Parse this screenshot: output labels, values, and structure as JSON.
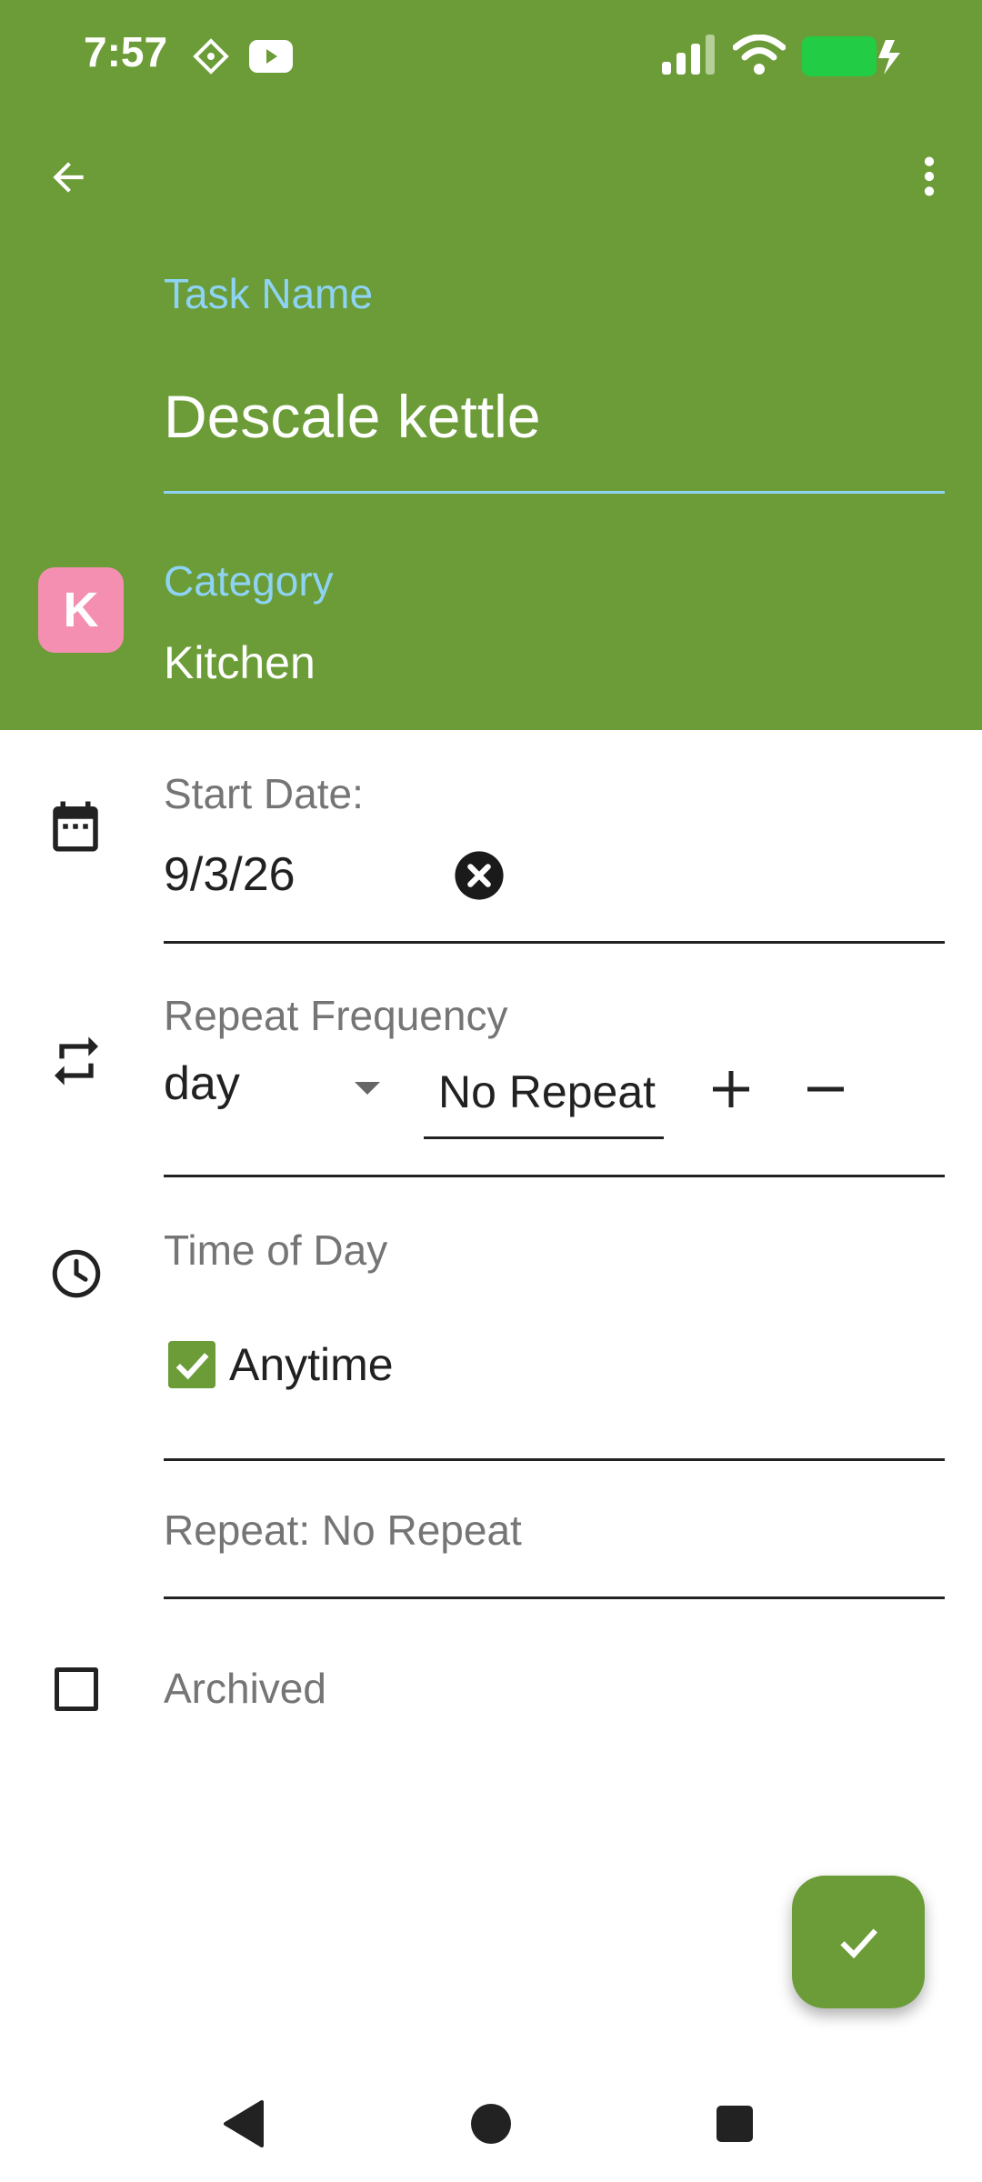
{
  "status": {
    "time": "7:57"
  },
  "colors": {
    "header": "#6b9c37",
    "accent_label": "#8fd3f4",
    "category_avatar": "#f48fb1",
    "checkbox_checked": "#6b9c37"
  },
  "icons": [
    "back-arrow-icon",
    "more-vert-icon",
    "calendar-icon",
    "repeat-icon",
    "clock-icon",
    "clear-icon",
    "dropdown-icon",
    "plus-icon",
    "minus-icon",
    "check-icon",
    "nav-back-icon",
    "nav-home-icon",
    "nav-recents-icon"
  ],
  "task": {
    "name_label": "Task Name",
    "name_value": "Descale kettle"
  },
  "category": {
    "avatar_letter": "K",
    "label": "Category",
    "value": "Kitchen"
  },
  "start_date": {
    "label": "Start Date:",
    "value": "9/3/26"
  },
  "repeat_frequency": {
    "label": "Repeat Frequency",
    "unit": "day",
    "value": "No Repeat"
  },
  "time_of_day": {
    "label": "Time of Day",
    "anytime_label": "Anytime",
    "anytime_checked": true
  },
  "repeat_summary": "Repeat: No Repeat",
  "archived": {
    "label": "Archived",
    "checked": false
  }
}
